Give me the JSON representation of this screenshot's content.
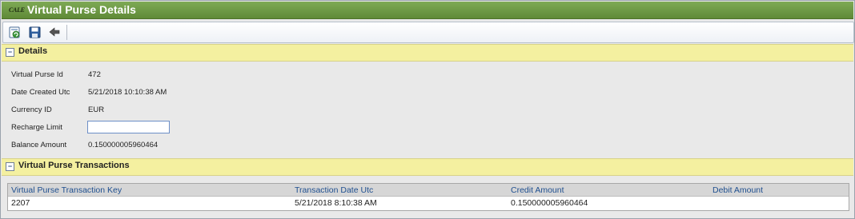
{
  "window": {
    "logo_text": "CALE",
    "title": "Virtual Purse Details"
  },
  "toolbar": {
    "buttons": [
      {
        "icon": "refresh-icon",
        "tooltip": ""
      },
      {
        "icon": "save-icon",
        "tooltip": ""
      },
      {
        "icon": "back-icon",
        "tooltip": ""
      }
    ]
  },
  "details": {
    "collapse_glyph": "−",
    "title": "Details",
    "fields": {
      "virtual_purse_id_label": "Virtual Purse Id",
      "virtual_purse_id_value": "472",
      "date_created_label": "Date Created Utc",
      "date_created_value": "5/21/2018 10:10:38 AM",
      "currency_label": "Currency ID",
      "currency_value": "EUR",
      "recharge_limit_label": "Recharge Limit",
      "recharge_limit_value": "",
      "balance_label": "Balance Amount",
      "balance_value": "0.150000005960464"
    }
  },
  "transactions": {
    "collapse_glyph": "−",
    "title": "Virtual Purse Transactions",
    "columns": [
      "Virtual Purse Transaction Key",
      "Transaction Date Utc",
      "Credit Amount",
      "Debit Amount"
    ],
    "rows": [
      [
        "2207",
        "5/21/2018 8:10:38 AM",
        "0.150000005960464",
        ""
      ]
    ]
  },
  "colors": {
    "title_bar": "#6b9a42",
    "section_header": "#f4f0a0",
    "grid_header_text": "#1f4f8f"
  }
}
